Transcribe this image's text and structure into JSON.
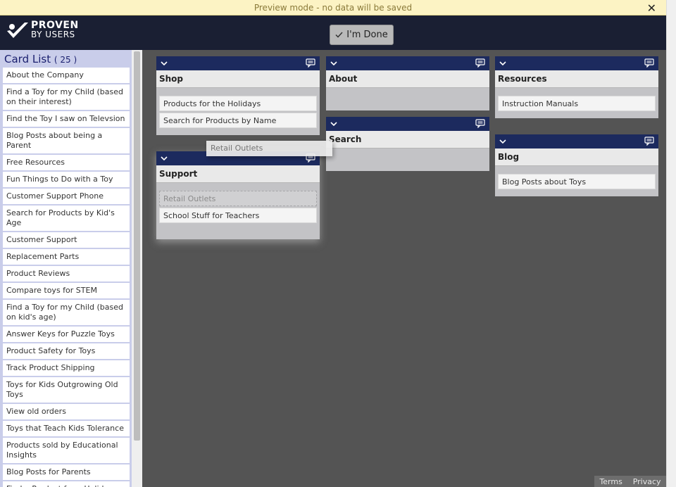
{
  "banner": {
    "text": "Preview mode - no data will be saved",
    "close": "✕"
  },
  "header": {
    "logo_line1": "PROVEN",
    "logo_line2": "BY USERS",
    "done_label": "I'm Done"
  },
  "sidebar": {
    "title": "Card List",
    "count": "( 25 )",
    "cards": [
      "About the Company",
      "Find a Toy for my Child (based on their interest)",
      "Find the Toy I saw on Televsion",
      "Blog Posts about being a Parent",
      "Free Resources",
      "Fun Things to Do with a Toy",
      "Customer Support Phone",
      "Search for Products by Kid's Age",
      "Customer Support",
      "Replacement Parts",
      "Product Reviews",
      "Compare toys for STEM",
      "Find a Toy for my Child (based on kid's age)",
      "Answer Keys for Puzzle Toys",
      "Product Safety for Toys",
      "Track Product Shipping",
      "Toys for Kids Outgrowing Old Toys",
      "View old orders",
      "Toys that Teach Kids Tolerance",
      "Products sold by Educational Insights",
      "Blog Posts for Parents",
      "Find a Product for a Holiday (Christmas, Easter)"
    ]
  },
  "categories": {
    "shop": {
      "title": "Shop",
      "cards": [
        "Products for the Holidays",
        "Search for Products by Name"
      ]
    },
    "support": {
      "title": "Support",
      "placeholder": "Retail Outlets",
      "cards": [
        "School Stuff for Teachers"
      ]
    },
    "about": {
      "title": "About",
      "cards": []
    },
    "search": {
      "title": "Search",
      "cards": []
    },
    "resources": {
      "title": "Resources",
      "cards": [
        "Instruction Manuals"
      ]
    },
    "blog": {
      "title": "Blog",
      "cards": [
        "Blog Posts about Toys"
      ]
    }
  },
  "drag_card": "Retail Outlets",
  "footer": {
    "terms": "Terms",
    "privacy": "Privacy"
  },
  "colors": {
    "category_header": "#1c2a5e",
    "sidebar_bg": "#c9cdea",
    "canvas_bg": "#545454",
    "banner_bg": "#fcf3c4"
  }
}
